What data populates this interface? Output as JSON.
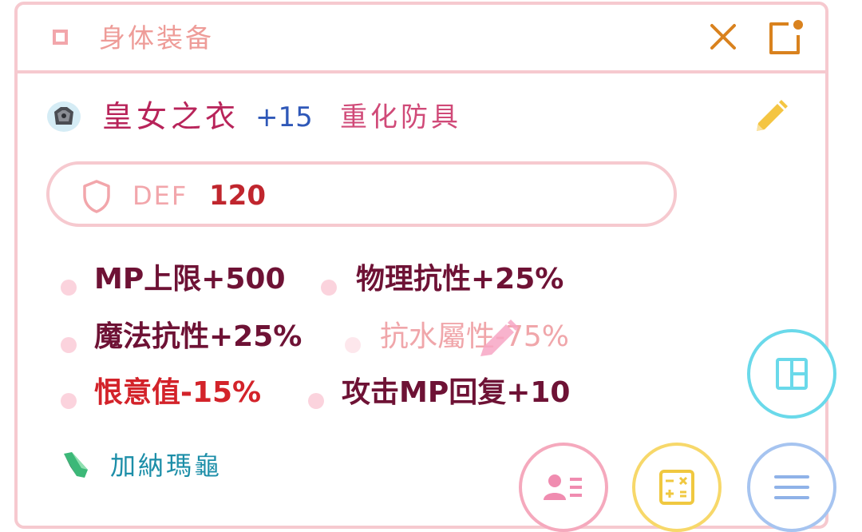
{
  "header": {
    "title": "身体装备",
    "close_icon": "close-icon",
    "popout_icon": "popout-icon"
  },
  "item": {
    "icon": "armor-icon",
    "name": "皇女之衣",
    "enhance": "+15",
    "category": "重化防具",
    "edit_icon": "pencil-icon"
  },
  "defense": {
    "icon": "shield-icon",
    "label": "DEF",
    "value": "120"
  },
  "stats": [
    {
      "text": "MP上限+500",
      "color": "#6e1235"
    },
    {
      "text": "物理抗性+25%",
      "color": "#6e1235"
    },
    {
      "text": "魔法抗性+25%",
      "color": "#6e1235"
    },
    {
      "text": "抗水屬性-75%",
      "color": "#f0a6aa"
    },
    {
      "text": "恨意值-15%",
      "color": "#d3232a"
    },
    {
      "text": "攻击MP回复+10",
      "color": "#6e1235"
    }
  ],
  "crystal": {
    "icon": "crystal-icon",
    "label": "加納瑪龜"
  },
  "fabs": [
    {
      "name": "layout-fab",
      "icon": "layout-icon",
      "color": "#6ad9ea"
    },
    {
      "name": "profile-fab",
      "icon": "id-card-icon",
      "color": "#f5a9bd"
    },
    {
      "name": "calculator-fab",
      "icon": "calculator-icon",
      "color": "#f7d86a"
    },
    {
      "name": "menu-fab",
      "icon": "menu-icon",
      "color": "#a6c4f0"
    }
  ],
  "colors": {
    "accent_pink": "#f6c9cf",
    "close_orange": "#d9821e",
    "pencil_yellow": "#f4c542"
  }
}
